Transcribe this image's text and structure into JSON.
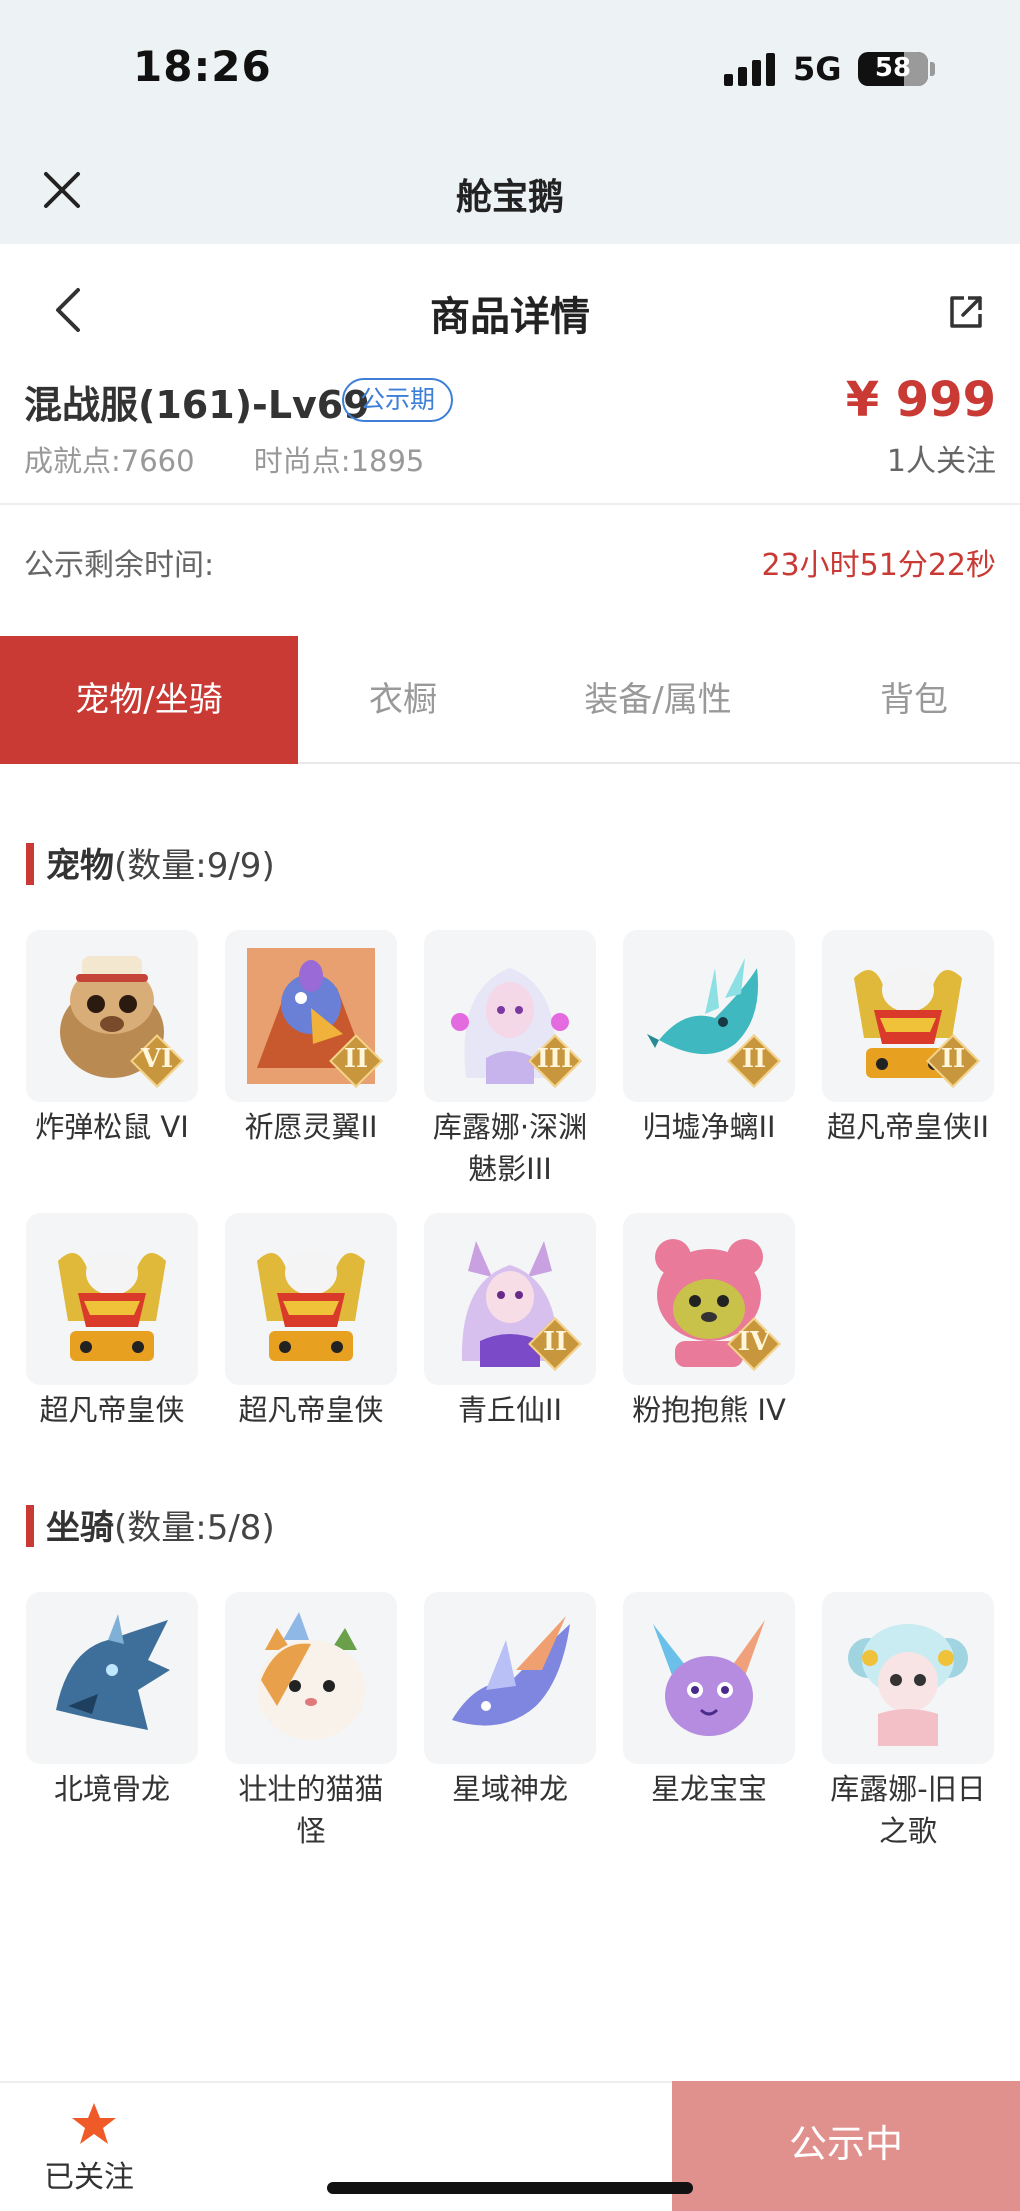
{
  "status_bar": {
    "time": "18:26",
    "network": "5G",
    "battery": "58"
  },
  "mini_app": {
    "title": "舱宝鹅"
  },
  "nav": {
    "title": "商品详情"
  },
  "product": {
    "name": "混战服(161)-Lv69",
    "badge": "公示期",
    "price": "¥ 999",
    "watchers": "1人关注",
    "achievement": "成就点:7660",
    "fashion": "时尚点:1895"
  },
  "countdown": {
    "label": "公示剩余时间:",
    "value": "23小时51分22秒"
  },
  "tabs": [
    {
      "label": "宠物/坐骑",
      "active": true
    },
    {
      "label": "衣橱",
      "active": false
    },
    {
      "label": "装备/属性",
      "active": false
    },
    {
      "label": "背包",
      "active": false
    }
  ],
  "pets": {
    "title": "宠物",
    "count": "(数量:9/9)",
    "items": [
      {
        "label": "炸弹松鼠 VI",
        "rank": "VI",
        "color": "#b98a52"
      },
      {
        "label": "祈愿灵翼II",
        "rank": "II",
        "color": "#6a7fd6"
      },
      {
        "label": "库露娜·深渊魅影III",
        "rank": "III",
        "color": "#d8c8f0"
      },
      {
        "label": "归墟净螭II",
        "rank": "II",
        "color": "#3fb8c0"
      },
      {
        "label": "超凡帝皇侠II",
        "rank": "II",
        "color": "#e0b93a"
      },
      {
        "label": "超凡帝皇侠",
        "rank": "",
        "color": "#e0b93a"
      },
      {
        "label": "超凡帝皇侠",
        "rank": "",
        "color": "#e0b93a"
      },
      {
        "label": "青丘仙II",
        "rank": "II",
        "color": "#c9a0e0"
      },
      {
        "label": "粉抱抱熊 IV",
        "rank": "IV",
        "color": "#e97a9a"
      }
    ]
  },
  "mounts": {
    "title": "坐骑",
    "count": "(数量:5/8)",
    "items": [
      {
        "label": "北境骨龙",
        "color": "#3d6f9a"
      },
      {
        "label": "壮壮的猫猫怪",
        "color": "#e9a04a"
      },
      {
        "label": "星域神龙",
        "color": "#7e86e0"
      },
      {
        "label": "星龙宝宝",
        "color": "#b58ce0"
      },
      {
        "label": "库露娜-旧日之歌",
        "color": "#9fd4e0"
      }
    ]
  },
  "bottom": {
    "follow_label": "已关注",
    "action": "公示中"
  },
  "colors": {
    "accent": "#c93a34",
    "badge": "#3d7fd6",
    "action_bg": "#e0908d"
  }
}
